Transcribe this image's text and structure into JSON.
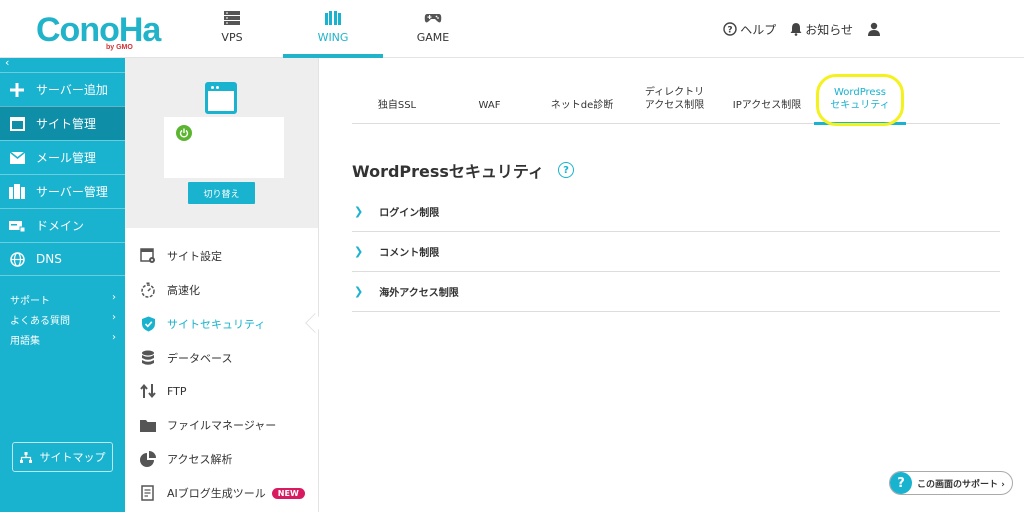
{
  "app": {
    "logo": "ConoHa",
    "logo_sub": "by GMO"
  },
  "global_tabs": [
    {
      "label": "VPS",
      "icon": "server-icon"
    },
    {
      "label": "WING",
      "icon": "wing-icon",
      "active": true
    },
    {
      "label": "GAME",
      "icon": "gamepad-icon"
    }
  ],
  "right_nav": {
    "help": "ヘルプ",
    "notice": "お知らせ"
  },
  "sidebar": {
    "collapse": "‹",
    "items": [
      {
        "label": "サーバー追加",
        "icon": "plus-icon"
      },
      {
        "label": "サイト管理",
        "icon": "window-icon",
        "active": true
      },
      {
        "label": "メール管理",
        "icon": "mail-icon"
      },
      {
        "label": "サーバー管理",
        "icon": "server-stack-icon"
      },
      {
        "label": "ドメイン",
        "icon": "domain-icon"
      },
      {
        "label": "DNS",
        "icon": "globe-icon"
      }
    ],
    "links": [
      "サポート",
      "よくある質問",
      "用語集"
    ],
    "sitemap": "サイトマップ"
  },
  "site": {
    "switch_label": "切り替え",
    "menu": [
      {
        "label": "サイト設定",
        "icon": "site-settings-icon"
      },
      {
        "label": "高速化",
        "icon": "stopwatch-icon"
      },
      {
        "label": "サイトセキュリティ",
        "icon": "shield-icon",
        "active": true
      },
      {
        "label": "データベース",
        "icon": "database-icon"
      },
      {
        "label": "FTP",
        "icon": "transfer-icon"
      },
      {
        "label": "ファイルマネージャー",
        "icon": "folder-icon"
      },
      {
        "label": "アクセス解析",
        "icon": "pie-chart-icon"
      },
      {
        "label": "AIブログ生成ツール",
        "icon": "document-icon",
        "badge": "NEW"
      }
    ]
  },
  "tabs": [
    {
      "label": "独自SSL"
    },
    {
      "label": "WAF"
    },
    {
      "label": "ネットde診断"
    },
    {
      "label": "ディレクトリ\nアクセス制限"
    },
    {
      "label": "IPアクセス制限"
    },
    {
      "label": "WordPress\nセキュリティ",
      "active": true
    }
  ],
  "main": {
    "title": "WordPressセキュリティ",
    "sections": [
      "ログイン制限",
      "コメント制限",
      "海外アクセス制限"
    ]
  },
  "support_button": "この画面のサポート ›",
  "colors": {
    "accent": "#19b2cf",
    "highlight": "#f4f11c",
    "badge": "#d81b60"
  }
}
